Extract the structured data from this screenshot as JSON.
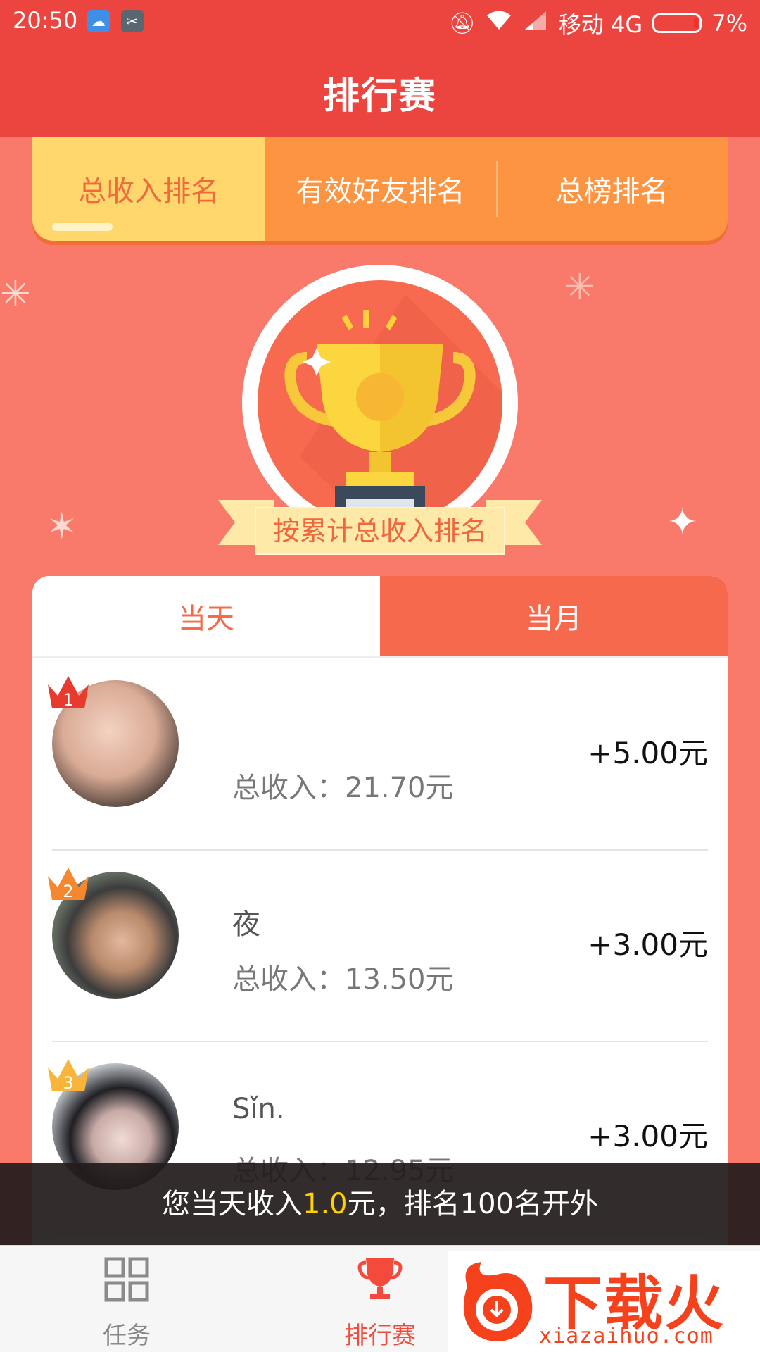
{
  "status_bar": {
    "time": "20:50",
    "carrier": "移动 4G",
    "battery": "7%"
  },
  "header": {
    "title": "排行赛"
  },
  "top_tabs": [
    {
      "label": "总收入排名",
      "active": true
    },
    {
      "label": "有效好友排名",
      "active": false
    },
    {
      "label": "总榜排名",
      "active": false
    }
  ],
  "banner": {
    "ribbon_label": "按累计总收入排名"
  },
  "sub_tabs": [
    {
      "label": "当天",
      "active": true
    },
    {
      "label": "当月",
      "active": false
    }
  ],
  "ranking": [
    {
      "rank": "1",
      "name": "",
      "income": "总收入：21.70元",
      "delta": "+5.00元",
      "crown_color": "#e83a2f"
    },
    {
      "rank": "2",
      "name": "夜",
      "income": "总收入：13.50元",
      "delta": "+3.00元",
      "crown_color": "#f6872f"
    },
    {
      "rank": "3",
      "name": "Sǐn.",
      "income": "总收入：12.95元",
      "delta": "+3.00元",
      "crown_color": "#f9b53a"
    }
  ],
  "toast": {
    "prefix": "您当天收入",
    "amount": "1.0",
    "suffix": "元，排名100名开外"
  },
  "bottom_nav": [
    {
      "label": "任务",
      "icon": "grid-icon",
      "active": false
    },
    {
      "label": "排行赛",
      "icon": "trophy-icon",
      "active": true
    }
  ],
  "watermark": {
    "brand": "下载火",
    "url": "xiazaihuo.com"
  },
  "colors": {
    "primary_red": "#ec4540",
    "background": "#f9796a",
    "tab_orange": "#fd9442",
    "tab_active_yellow": "#ffd76d",
    "accent_coral": "#f7694c"
  }
}
